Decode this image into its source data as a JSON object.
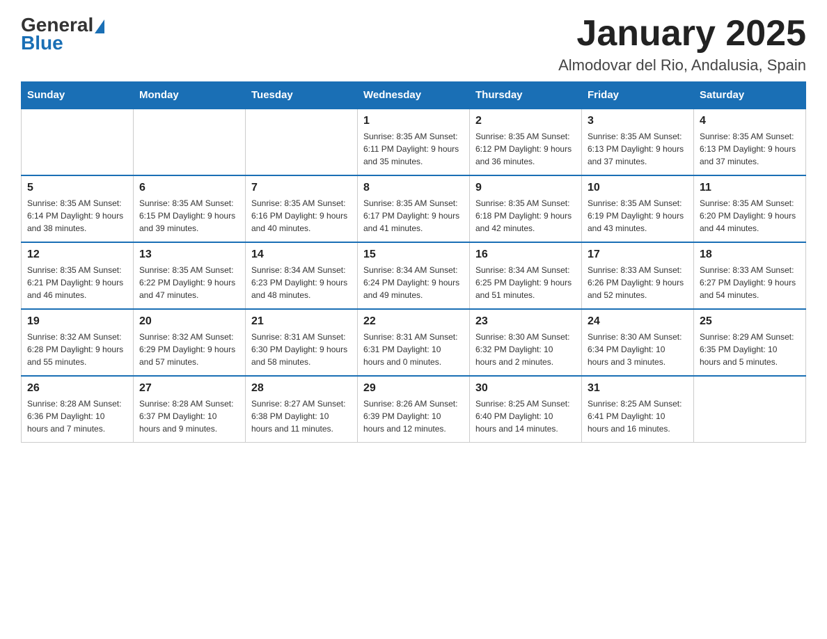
{
  "header": {
    "title": "January 2025",
    "subtitle": "Almodovar del Rio, Andalusia, Spain",
    "logo_general": "General",
    "logo_blue": "Blue"
  },
  "days_of_week": [
    "Sunday",
    "Monday",
    "Tuesday",
    "Wednesday",
    "Thursday",
    "Friday",
    "Saturday"
  ],
  "weeks": [
    [
      {
        "day": "",
        "info": ""
      },
      {
        "day": "",
        "info": ""
      },
      {
        "day": "",
        "info": ""
      },
      {
        "day": "1",
        "info": "Sunrise: 8:35 AM\nSunset: 6:11 PM\nDaylight: 9 hours\nand 35 minutes."
      },
      {
        "day": "2",
        "info": "Sunrise: 8:35 AM\nSunset: 6:12 PM\nDaylight: 9 hours\nand 36 minutes."
      },
      {
        "day": "3",
        "info": "Sunrise: 8:35 AM\nSunset: 6:13 PM\nDaylight: 9 hours\nand 37 minutes."
      },
      {
        "day": "4",
        "info": "Sunrise: 8:35 AM\nSunset: 6:13 PM\nDaylight: 9 hours\nand 37 minutes."
      }
    ],
    [
      {
        "day": "5",
        "info": "Sunrise: 8:35 AM\nSunset: 6:14 PM\nDaylight: 9 hours\nand 38 minutes."
      },
      {
        "day": "6",
        "info": "Sunrise: 8:35 AM\nSunset: 6:15 PM\nDaylight: 9 hours\nand 39 minutes."
      },
      {
        "day": "7",
        "info": "Sunrise: 8:35 AM\nSunset: 6:16 PM\nDaylight: 9 hours\nand 40 minutes."
      },
      {
        "day": "8",
        "info": "Sunrise: 8:35 AM\nSunset: 6:17 PM\nDaylight: 9 hours\nand 41 minutes."
      },
      {
        "day": "9",
        "info": "Sunrise: 8:35 AM\nSunset: 6:18 PM\nDaylight: 9 hours\nand 42 minutes."
      },
      {
        "day": "10",
        "info": "Sunrise: 8:35 AM\nSunset: 6:19 PM\nDaylight: 9 hours\nand 43 minutes."
      },
      {
        "day": "11",
        "info": "Sunrise: 8:35 AM\nSunset: 6:20 PM\nDaylight: 9 hours\nand 44 minutes."
      }
    ],
    [
      {
        "day": "12",
        "info": "Sunrise: 8:35 AM\nSunset: 6:21 PM\nDaylight: 9 hours\nand 46 minutes."
      },
      {
        "day": "13",
        "info": "Sunrise: 8:35 AM\nSunset: 6:22 PM\nDaylight: 9 hours\nand 47 minutes."
      },
      {
        "day": "14",
        "info": "Sunrise: 8:34 AM\nSunset: 6:23 PM\nDaylight: 9 hours\nand 48 minutes."
      },
      {
        "day": "15",
        "info": "Sunrise: 8:34 AM\nSunset: 6:24 PM\nDaylight: 9 hours\nand 49 minutes."
      },
      {
        "day": "16",
        "info": "Sunrise: 8:34 AM\nSunset: 6:25 PM\nDaylight: 9 hours\nand 51 minutes."
      },
      {
        "day": "17",
        "info": "Sunrise: 8:33 AM\nSunset: 6:26 PM\nDaylight: 9 hours\nand 52 minutes."
      },
      {
        "day": "18",
        "info": "Sunrise: 8:33 AM\nSunset: 6:27 PM\nDaylight: 9 hours\nand 54 minutes."
      }
    ],
    [
      {
        "day": "19",
        "info": "Sunrise: 8:32 AM\nSunset: 6:28 PM\nDaylight: 9 hours\nand 55 minutes."
      },
      {
        "day": "20",
        "info": "Sunrise: 8:32 AM\nSunset: 6:29 PM\nDaylight: 9 hours\nand 57 minutes."
      },
      {
        "day": "21",
        "info": "Sunrise: 8:31 AM\nSunset: 6:30 PM\nDaylight: 9 hours\nand 58 minutes."
      },
      {
        "day": "22",
        "info": "Sunrise: 8:31 AM\nSunset: 6:31 PM\nDaylight: 10 hours\nand 0 minutes."
      },
      {
        "day": "23",
        "info": "Sunrise: 8:30 AM\nSunset: 6:32 PM\nDaylight: 10 hours\nand 2 minutes."
      },
      {
        "day": "24",
        "info": "Sunrise: 8:30 AM\nSunset: 6:34 PM\nDaylight: 10 hours\nand 3 minutes."
      },
      {
        "day": "25",
        "info": "Sunrise: 8:29 AM\nSunset: 6:35 PM\nDaylight: 10 hours\nand 5 minutes."
      }
    ],
    [
      {
        "day": "26",
        "info": "Sunrise: 8:28 AM\nSunset: 6:36 PM\nDaylight: 10 hours\nand 7 minutes."
      },
      {
        "day": "27",
        "info": "Sunrise: 8:28 AM\nSunset: 6:37 PM\nDaylight: 10 hours\nand 9 minutes."
      },
      {
        "day": "28",
        "info": "Sunrise: 8:27 AM\nSunset: 6:38 PM\nDaylight: 10 hours\nand 11 minutes."
      },
      {
        "day": "29",
        "info": "Sunrise: 8:26 AM\nSunset: 6:39 PM\nDaylight: 10 hours\nand 12 minutes."
      },
      {
        "day": "30",
        "info": "Sunrise: 8:25 AM\nSunset: 6:40 PM\nDaylight: 10 hours\nand 14 minutes."
      },
      {
        "day": "31",
        "info": "Sunrise: 8:25 AM\nSunset: 6:41 PM\nDaylight: 10 hours\nand 16 minutes."
      },
      {
        "day": "",
        "info": ""
      }
    ]
  ]
}
